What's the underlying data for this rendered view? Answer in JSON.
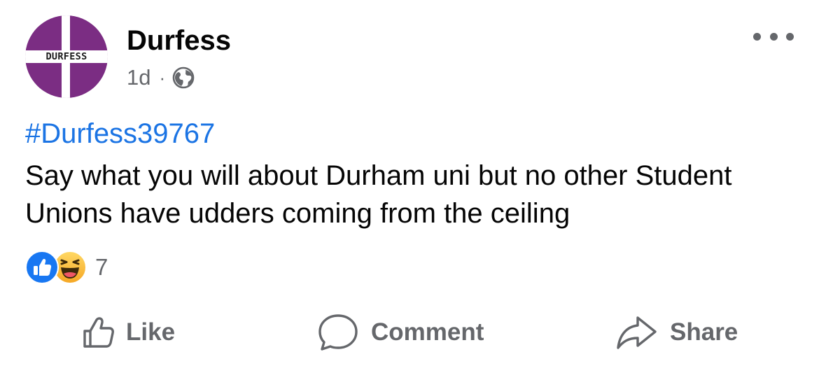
{
  "post": {
    "author": "Durfess",
    "avatar_text": "DURFESS",
    "time": "1d",
    "separator": "·",
    "privacy_icon": "globe-icon",
    "hashtag": "#Durfess39767",
    "text": "Say what you will about Durham uni but no other Student Unions have udders coming from the ceiling",
    "reactions": {
      "icons": [
        "like-reaction-icon",
        "haha-reaction-icon"
      ],
      "count": "7"
    }
  },
  "actions": {
    "like_label": "Like",
    "comment_label": "Comment",
    "share_label": "Share"
  },
  "colors": {
    "avatar_purple": "#7b2d83",
    "link_blue": "#1b74e4",
    "secondary_text": "#65676b",
    "like_blue": "#1877f2"
  }
}
